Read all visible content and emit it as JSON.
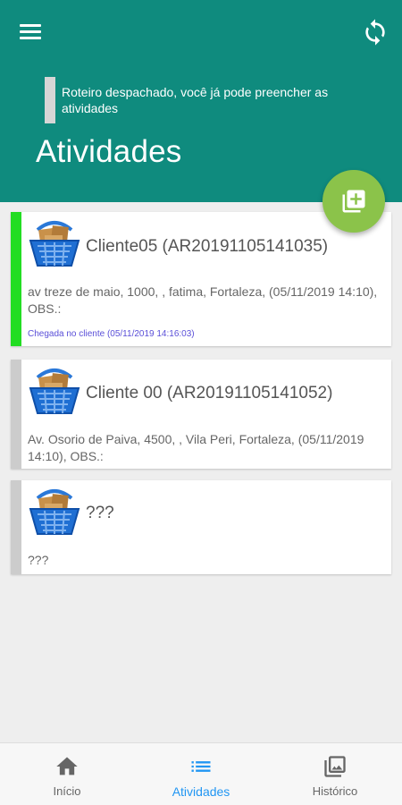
{
  "header": {
    "notice": "Roteiro despachado, você já pode preencher as atividades",
    "title": "Atividades",
    "color": "#0f8b7e"
  },
  "icons": {
    "menu": "menu-icon",
    "sync": "sync-icon",
    "add": "add-box-icon",
    "basket": "basket-icon",
    "home": "home-icon",
    "list": "list-icon",
    "history": "image-gallery-icon"
  },
  "fab": {
    "color": "#8bc34a"
  },
  "activities": [
    {
      "title": "Cliente05 (AR20191105141035)",
      "address": "av treze de maio, 1000, , fatima, Fortaleza, (05/11/2019 14:10), OBS.:",
      "arrival": "Chegada no cliente (05/11/2019 14:16:03)",
      "status_color": "#22dd22"
    },
    {
      "title": "Cliente 00 (AR20191105141052)",
      "address": "Av. Osorio de Paiva, 4500, , Vila Peri, Fortaleza, (05/11/2019 14:10), OBS.:",
      "status_color": "#cccccc"
    },
    {
      "title": "???",
      "address": "???",
      "status_color": "#cccccc"
    }
  ],
  "bottom_nav": [
    {
      "label": "Início",
      "active": false
    },
    {
      "label": "Atividades",
      "active": true
    },
    {
      "label": "Histórico",
      "active": false
    }
  ]
}
